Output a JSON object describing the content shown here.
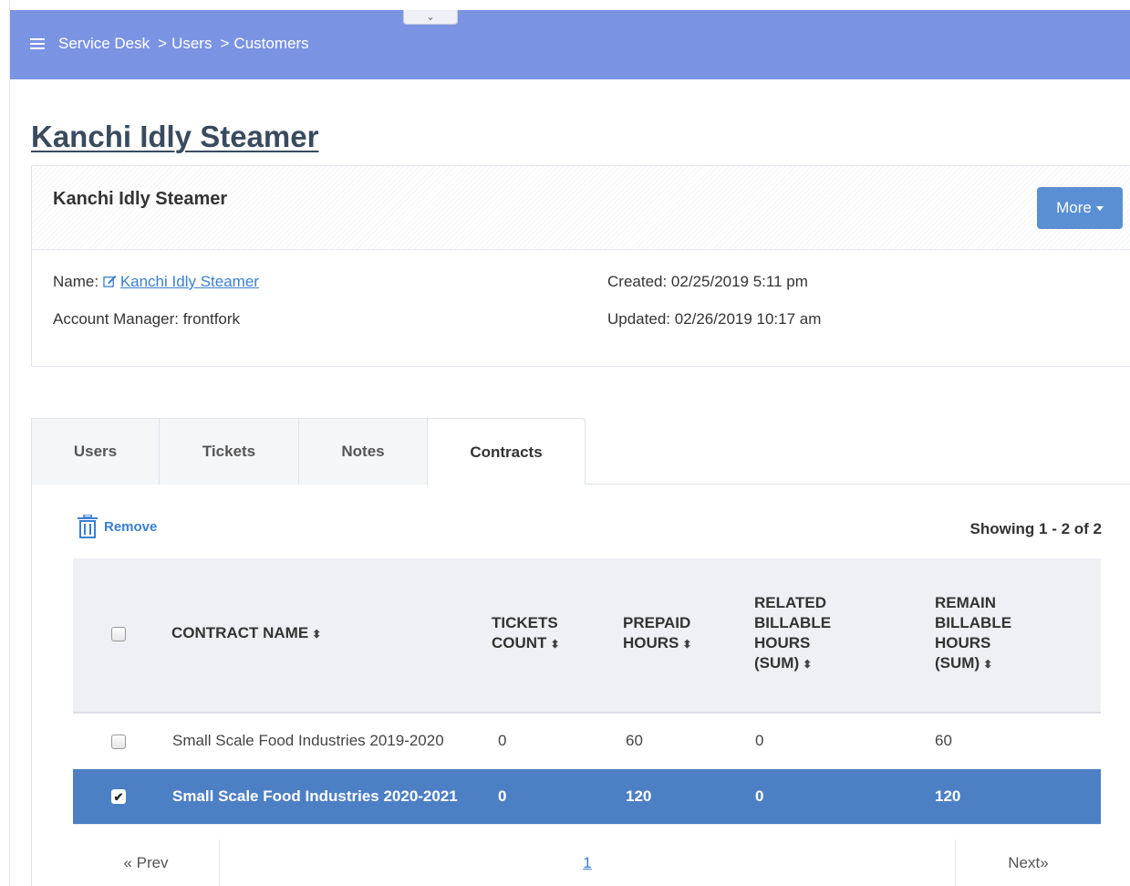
{
  "header": {
    "collapse_icon": "chevron-down-icon",
    "menu_icon": "hamburger-icon",
    "breadcrumb": [
      "Service Desk",
      "Users",
      "Customers"
    ],
    "separator": ">",
    "background": "#7b93e3"
  },
  "page_title": "Kanchi Idly Steamer",
  "card": {
    "title": "Kanchi Idly Steamer",
    "more_label": "More",
    "name_label": "Name:",
    "name_value": "Kanchi Idly Steamer",
    "account_manager": "Account Manager: frontfork",
    "created": "Created: 02/25/2019 5:11 pm",
    "updated": "Updated: 02/26/2019 10:17 am"
  },
  "tabs": [
    {
      "label": "Users",
      "active": false
    },
    {
      "label": "Tickets",
      "active": false
    },
    {
      "label": "Notes",
      "active": false
    },
    {
      "label": "Contracts",
      "active": true
    }
  ],
  "toolbar": {
    "remove_label": "Remove",
    "remove_icon": "trash-icon",
    "showing": "Showing 1 - 2 of 2"
  },
  "table": {
    "columns": [
      {
        "line1": "CONTRACT NAME",
        "line2": "",
        "line3": "",
        "line4": ""
      },
      {
        "line1": "TICKETS",
        "line2": "COUNT",
        "line3": "",
        "line4": ""
      },
      {
        "line1": "PREPAID",
        "line2": "HOURS",
        "line3": "",
        "line4": ""
      },
      {
        "line1": "RELATED",
        "line2": "BILLABLE",
        "line3": "HOURS",
        "line4": "(SUM)"
      },
      {
        "line1": "REMAIN",
        "line2": "BILLABLE",
        "line3": "HOURS",
        "line4": "(SUM)"
      }
    ],
    "sort_glyph": "⬍",
    "rows": [
      {
        "checked": false,
        "name": "Small Scale Food Industries 2019-2020",
        "tickets": "0",
        "prepaid": "60",
        "related": "0",
        "remain": "60"
      },
      {
        "checked": true,
        "name": "Small Scale Food Industries 2020-2021",
        "tickets": "0",
        "prepaid": "120",
        "related": "0",
        "remain": "120"
      }
    ],
    "selected_color": "#4d7fc5"
  },
  "pager": {
    "prev": "« Prev",
    "page": "1",
    "next": "Next»"
  }
}
